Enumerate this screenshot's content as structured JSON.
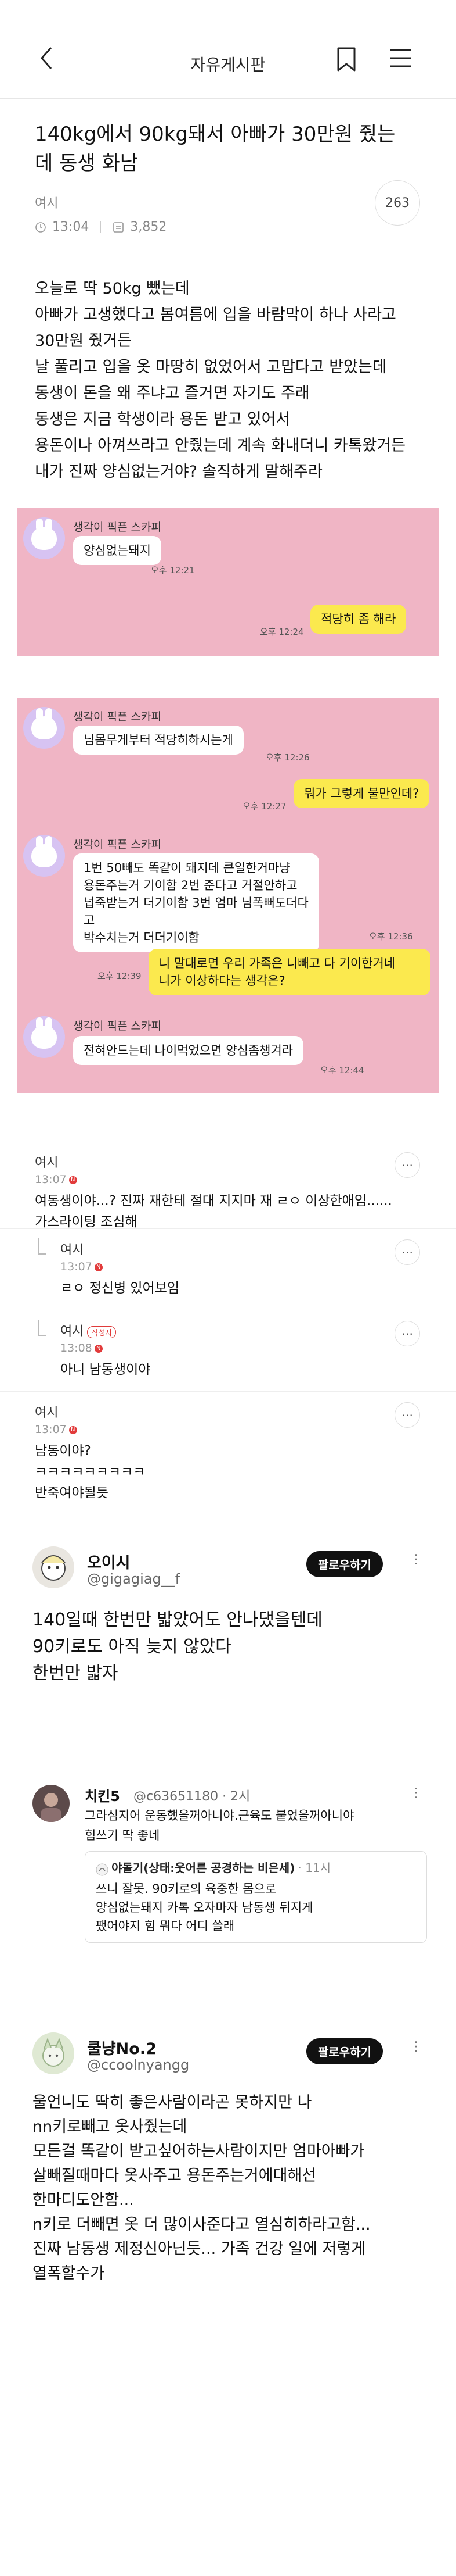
{
  "header": {
    "title": "자유게시판"
  },
  "post": {
    "title": "140kg에서 90kg돼서 아빠가 30만원 줬는데 동생 화남",
    "author": "여시",
    "time": "13:04",
    "views": "3,852",
    "comment_count": "263",
    "body": [
      "오늘로 딱 50kg 뺐는데",
      "아빠가 고생했다고 봄여름에 입을 바람막이 하나 사라고",
      "30만원 줬거든",
      "날 풀리고 입을 옷 마땅히 없었어서 고맙다고 받았는데",
      "동생이 돈을 왜 주냐고 즐거면 자기도 주래",
      "동생은 지금 학생이라 용돈 받고 있어서",
      "용돈이나 아껴쓰라고 안줬는데 계속 화내더니 카톡왔거든",
      "내가 진짜 양심없는거야? 솔직하게 말해주라"
    ]
  },
  "chat1": {
    "nick": "생각이 픽픈 스카피",
    "msg1": "양심없는돼지",
    "time1": "오후 12:21",
    "reply": "적당히 좀 해라",
    "time2": "오후 12:24"
  },
  "chat2": {
    "nick": "생각이 픽픈 스카피",
    "msg1": "님몸무게부터 적당히하시는게",
    "time1": "오후 12:26",
    "reply1": "뭐가 그렇게 불만인데?",
    "time2": "오후 12:27",
    "msg2": "1번 50빼도 똑같이 돼지데 큰일한거마냥\n용돈주는거 기이함 2번 준다고 거절안하고\n넙죽받는거 더기이함 3번 엄마 님폭뻐도더다고\n박수치는거 더더기이함",
    "time3": "오후 12:36",
    "reply2": "니 말대로면 우리 가족은 니빼고 다 기이한거네\n니가 이상하다는 생각은?",
    "time4": "오후 12:39",
    "msg3": "전혀안드는데 나이먹었으면 양심좀챙겨라",
    "time5": "오후 12:44"
  },
  "comments": [
    {
      "name": "여시",
      "time": "13:07",
      "text": "여동생이야...? 진짜 재한테 절대 지지마 재 ㄹㅇ 이상한애임......\n가스라이팅 조심해"
    },
    {
      "name": "여시",
      "time": "13:07",
      "text": "ㄹㅇ 정신병 있어보임"
    },
    {
      "name": "여시",
      "badge": "작성자",
      "time": "13:08",
      "text": "아니 남동생이야"
    },
    {
      "name": "여시",
      "time": "13:07",
      "text": "남동이야?\nㅋㅋㅋㅋㅋㅋㅋㅋㅋ\n반죽여야될듯"
    }
  ],
  "tweet1": {
    "name": "오이시",
    "handle": "@gigagiag__f",
    "follow": "팔로우하기",
    "more": "⋮",
    "text": "140일때 한번만 밟았어도 안나댔을텐데\n90키로도 아직 늦지 않았다\n한번만 밟자"
  },
  "tweet2": {
    "name": "치킨5",
    "handle": "@c63651180 · 2시",
    "more": "⋮",
    "text": "그라심지어 운동했을꺼아니야.근육도 붙었을꺼아니야\n힘쓰기 딱 좋네",
    "quote_name": "야돌기(상태:웃어른 공경하는 비은세)",
    "quote_time": "· 11시",
    "quote_text": "쓰니 잘못. 90키로의 육중한 몸으로\n양심없는돼지 카톡 오자마자 남동생 뒤지게\n팼어야지 힘 뭐다 어디 쓸래"
  },
  "tweet3": {
    "name": "쿨냥No.2",
    "handle": "@ccoolnyangg",
    "follow": "팔로우하기",
    "more": "⋮",
    "text": "울언니도 딱히 좋은사람이라곤 못하지만 나\nnn키로빼고 옷사줬는데\n모든걸 똑같이 받고싶어하는사람이지만 엄마아빠가\n살빼질때마다 옷사주고 용돈주는거에대해선\n한마디도안함...\nn키로 더빼면 옷 더 많이사준다고 열심히하라고함...\n진짜 남동생 제정신아닌듯... 가족 건강 일에 저렇게\n열폭할수가"
  },
  "colors": {
    "chat_bg": "#f0b5c5",
    "my_bubble": "#fbe94e",
    "avatar": "#d7c3f2"
  }
}
